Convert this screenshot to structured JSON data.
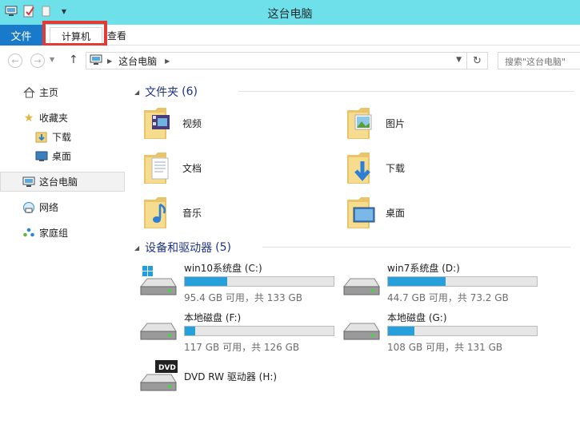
{
  "window": {
    "title": "这台电脑"
  },
  "ribbon": {
    "file_tab": "文件",
    "computer_tab": "计算机",
    "view_tab": "查看"
  },
  "address": {
    "crumb": "这台电脑",
    "search_placeholder": "搜索\"这台电脑\""
  },
  "sidebar": {
    "home": "主页",
    "favorites": "收藏夹",
    "downloads": "下载",
    "desktop": "桌面",
    "this_pc": "这台电脑",
    "network": "网络",
    "homegroup": "家庭组"
  },
  "folders_group": {
    "title": "文件夹",
    "count": "(6)"
  },
  "folders": [
    {
      "name": "视频",
      "icon": "video-folder-icon"
    },
    {
      "name": "图片",
      "icon": "pictures-folder-icon"
    },
    {
      "name": "文档",
      "icon": "documents-folder-icon"
    },
    {
      "name": "下载",
      "icon": "downloads-folder-icon"
    },
    {
      "name": "音乐",
      "icon": "music-folder-icon"
    },
    {
      "name": "桌面",
      "icon": "desktop-folder-icon"
    }
  ],
  "drives_group": {
    "title": "设备和驱动器",
    "count": "(5)"
  },
  "drives": [
    {
      "name": "win10系统盘 (C:)",
      "free": "95.4 GB 可用，共 133 GB",
      "used_fraction": 0.283
    },
    {
      "name": "win7系统盘 (D:)",
      "free": "44.7 GB 可用，共 73.2 GB",
      "used_fraction": 0.389
    },
    {
      "name": "本地磁盘 (F:)",
      "free": "117 GB 可用，共 126 GB",
      "used_fraction": 0.071
    },
    {
      "name": "本地磁盘 (G:)",
      "free": "108 GB 可用，共 131 GB",
      "used_fraction": 0.176
    },
    {
      "name": "DVD RW 驱动器 (H:)"
    }
  ],
  "colors": {
    "titlebar": "#6ee0ea",
    "file_tab": "#1979ca",
    "highlight": "#e53935",
    "drive_fill": "#26a0da",
    "group_header": "#1e3287"
  }
}
